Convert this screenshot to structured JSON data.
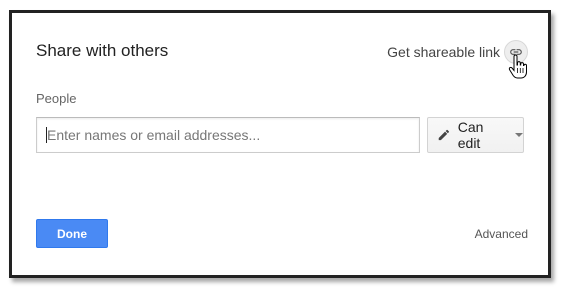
{
  "dialog": {
    "title": "Share with others",
    "share_link_label": "Get shareable link",
    "share_link_icon": "link-icon",
    "people_label": "People",
    "people_input": {
      "placeholder": "Enter names or email addresses...",
      "value": ""
    },
    "permission": {
      "icon": "pencil-icon",
      "selected": "Can edit"
    },
    "done_label": "Done",
    "advanced_label": "Advanced"
  },
  "colors": {
    "primary_button": "#4a8af4",
    "dialog_border": "#222222"
  }
}
